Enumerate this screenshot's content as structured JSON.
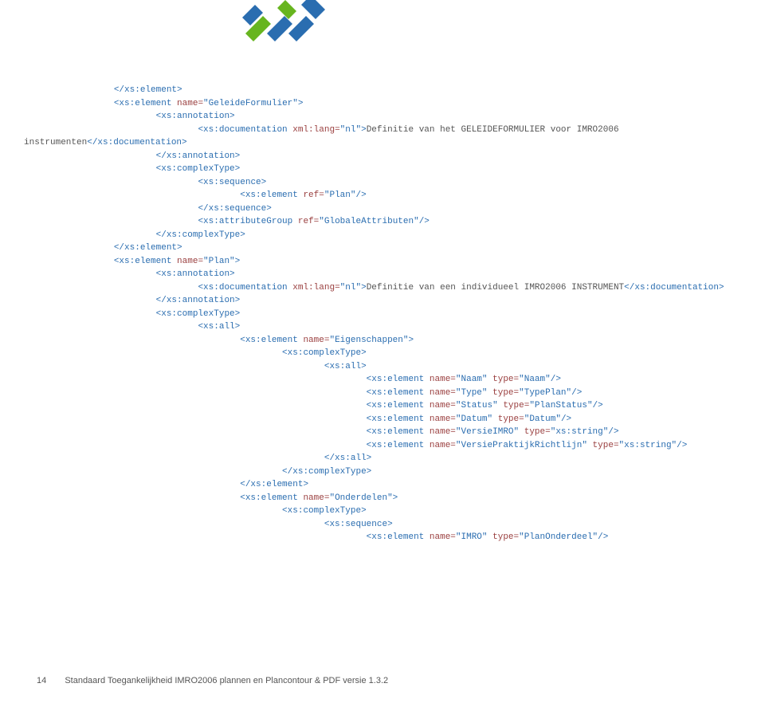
{
  "footer": {
    "page": "14",
    "text": "Standaard Toegankelijkheid IMRO2006 plannen en Plancontour & PDF  versie 1.3.2"
  },
  "code": {
    "pieces": [
      {
        "indent": 0,
        "runs": [
          {
            "c": "tag",
            "t": "</xs:element>"
          }
        ]
      },
      {
        "indent": 0,
        "runs": [
          {
            "c": "tag",
            "t": "<xs:element"
          },
          {
            "c": "attr",
            "t": " name="
          },
          {
            "c": "tag",
            "t": "\"GeleideFormulier\">"
          }
        ]
      },
      {
        "indent": 2,
        "runs": [
          {
            "c": "tag",
            "t": "<xs:annotation>"
          }
        ]
      },
      {
        "indent": 4,
        "runs": [
          {
            "c": "tag",
            "t": "<xs:documentation"
          },
          {
            "c": "attr",
            "t": " xml:lang="
          },
          {
            "c": "tag",
            "t": "\"nl\">"
          },
          {
            "c": "",
            "t": "Definitie van het GELEIDEFORMULIER voor IMRO2006"
          }
        ]
      },
      {
        "indent": -8,
        "runs": [
          {
            "c": "",
            "t": "instrumenten"
          },
          {
            "c": "tag",
            "t": "</xs:documentation>"
          }
        ]
      },
      {
        "indent": 2,
        "runs": [
          {
            "c": "tag",
            "t": "</xs:annotation>"
          }
        ]
      },
      {
        "indent": 2,
        "runs": [
          {
            "c": "tag",
            "t": "<xs:complexType>"
          }
        ]
      },
      {
        "indent": 4,
        "runs": [
          {
            "c": "tag",
            "t": "<xs:sequence>"
          }
        ]
      },
      {
        "indent": 6,
        "runs": [
          {
            "c": "tag",
            "t": "<xs:element"
          },
          {
            "c": "attr",
            "t": " ref="
          },
          {
            "c": "tag",
            "t": "\"Plan\"/>"
          }
        ]
      },
      {
        "indent": 4,
        "runs": [
          {
            "c": "tag",
            "t": "</xs:sequence>"
          }
        ]
      },
      {
        "indent": 4,
        "runs": [
          {
            "c": "tag",
            "t": "<xs:attributeGroup"
          },
          {
            "c": "attr",
            "t": " ref="
          },
          {
            "c": "tag",
            "t": "\"GlobaleAttributen\"/>"
          }
        ]
      },
      {
        "indent": 2,
        "runs": [
          {
            "c": "tag",
            "t": "</xs:complexType>"
          }
        ]
      },
      {
        "indent": 0,
        "runs": [
          {
            "c": "tag",
            "t": "</xs:element>"
          }
        ]
      },
      {
        "indent": 0,
        "runs": [
          {
            "c": "tag",
            "t": "<xs:element"
          },
          {
            "c": "attr",
            "t": " name="
          },
          {
            "c": "tag",
            "t": "\"Plan\">"
          }
        ]
      },
      {
        "indent": 2,
        "runs": [
          {
            "c": "tag",
            "t": "<xs:annotation>"
          }
        ]
      },
      {
        "indent": 4,
        "runs": [
          {
            "c": "tag",
            "t": "<xs:documentation"
          },
          {
            "c": "attr",
            "t": " xml:lang="
          },
          {
            "c": "tag",
            "t": "\"nl\">"
          },
          {
            "c": "",
            "t": "Definitie van een individueel IMRO2006 INSTRUMENT"
          },
          {
            "c": "tag",
            "t": "</xs:documentation>"
          }
        ]
      },
      {
        "indent": 2,
        "runs": [
          {
            "c": "tag",
            "t": "</xs:annotation>"
          }
        ]
      },
      {
        "indent": 2,
        "runs": [
          {
            "c": "tag",
            "t": "<xs:complexType>"
          }
        ]
      },
      {
        "indent": 4,
        "runs": [
          {
            "c": "tag",
            "t": "<xs:all>"
          }
        ]
      },
      {
        "indent": 6,
        "runs": [
          {
            "c": "tag",
            "t": "<xs:element"
          },
          {
            "c": "attr",
            "t": " name="
          },
          {
            "c": "tag",
            "t": "\"Eigenschappen\">"
          }
        ]
      },
      {
        "indent": 8,
        "runs": [
          {
            "c": "tag",
            "t": "<xs:complexType>"
          }
        ]
      },
      {
        "indent": 10,
        "runs": [
          {
            "c": "tag",
            "t": "<xs:all>"
          }
        ]
      },
      {
        "indent": 12,
        "runs": [
          {
            "c": "tag",
            "t": "<xs:element"
          },
          {
            "c": "attr",
            "t": " name="
          },
          {
            "c": "tag",
            "t": "\"Naam\""
          },
          {
            "c": "attr",
            "t": " type="
          },
          {
            "c": "tag",
            "t": "\"Naam\"/>"
          }
        ]
      },
      {
        "indent": 12,
        "runs": [
          {
            "c": "tag",
            "t": "<xs:element"
          },
          {
            "c": "attr",
            "t": " name="
          },
          {
            "c": "tag",
            "t": "\"Type\""
          },
          {
            "c": "attr",
            "t": " type="
          },
          {
            "c": "tag",
            "t": "\"TypePlan\"/>"
          }
        ]
      },
      {
        "indent": 12,
        "runs": [
          {
            "c": "tag",
            "t": "<xs:element"
          },
          {
            "c": "attr",
            "t": " name="
          },
          {
            "c": "tag",
            "t": "\"Status\""
          },
          {
            "c": "attr",
            "t": " type="
          },
          {
            "c": "tag",
            "t": "\"PlanStatus\"/>"
          }
        ]
      },
      {
        "indent": 12,
        "runs": [
          {
            "c": "tag",
            "t": "<xs:element"
          },
          {
            "c": "attr",
            "t": " name="
          },
          {
            "c": "tag",
            "t": "\"Datum\""
          },
          {
            "c": "attr",
            "t": " type="
          },
          {
            "c": "tag",
            "t": "\"Datum\"/>"
          }
        ]
      },
      {
        "indent": 12,
        "runs": [
          {
            "c": "tag",
            "t": "<xs:element"
          },
          {
            "c": "attr",
            "t": " name="
          },
          {
            "c": "tag",
            "t": "\"VersieIMRO\""
          },
          {
            "c": "attr",
            "t": " type="
          },
          {
            "c": "tag",
            "t": "\"xs:string\"/>"
          }
        ]
      },
      {
        "indent": 12,
        "runs": [
          {
            "c": "tag",
            "t": "<xs:element"
          },
          {
            "c": "attr",
            "t": " name="
          },
          {
            "c": "tag",
            "t": "\"VersiePraktijkRichtlijn\""
          },
          {
            "c": "attr",
            "t": " type="
          },
          {
            "c": "tag",
            "t": "\"xs:string\"/>"
          }
        ]
      },
      {
        "indent": 10,
        "runs": [
          {
            "c": "tag",
            "t": "</xs:all>"
          }
        ]
      },
      {
        "indent": 8,
        "runs": [
          {
            "c": "tag",
            "t": "</xs:complexType>"
          }
        ]
      },
      {
        "indent": 6,
        "runs": [
          {
            "c": "tag",
            "t": "</xs:element>"
          }
        ]
      },
      {
        "indent": 6,
        "runs": [
          {
            "c": "tag",
            "t": "<xs:element"
          },
          {
            "c": "attr",
            "t": " name="
          },
          {
            "c": "tag",
            "t": "\"Onderdelen\">"
          }
        ]
      },
      {
        "indent": 8,
        "runs": [
          {
            "c": "tag",
            "t": "<xs:complexType>"
          }
        ]
      },
      {
        "indent": 10,
        "runs": [
          {
            "c": "tag",
            "t": "<xs:sequence>"
          }
        ]
      },
      {
        "indent": 12,
        "runs": [
          {
            "c": "tag",
            "t": "<xs:element"
          },
          {
            "c": "attr",
            "t": " name="
          },
          {
            "c": "tag",
            "t": "\"IMRO\""
          },
          {
            "c": "attr",
            "t": " type="
          },
          {
            "c": "tag",
            "t": "\"PlanOnderdeel\"/>"
          }
        ]
      }
    ]
  }
}
